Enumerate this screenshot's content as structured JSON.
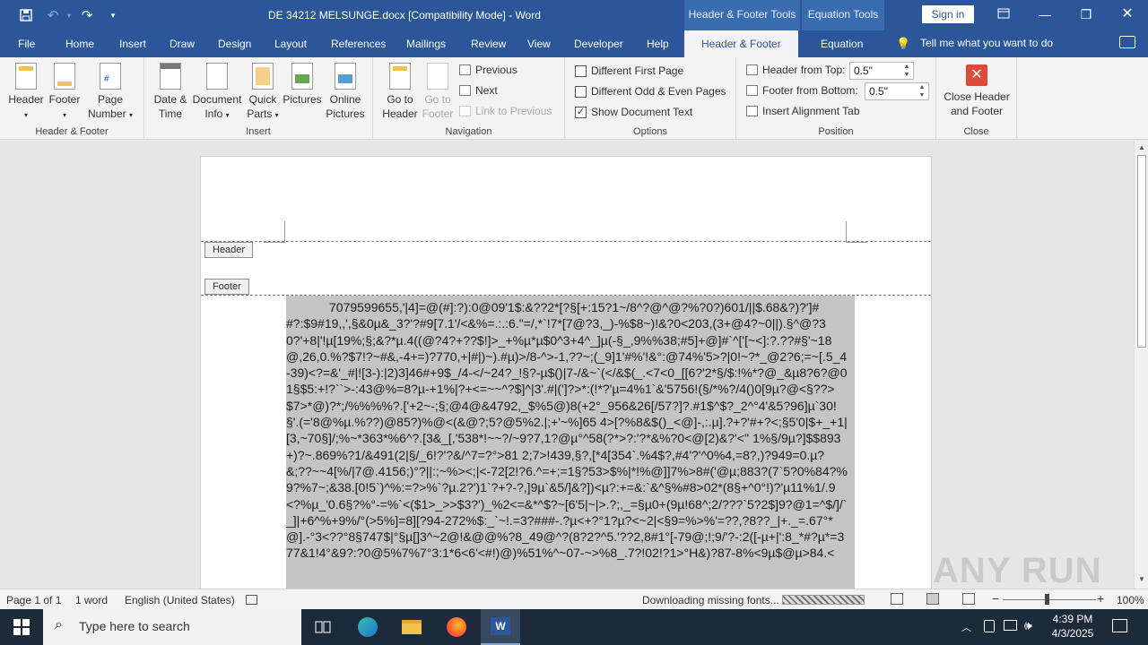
{
  "titlebar": {
    "doc_title": "DE 34212 MELSUNGE.docx  [Compatibility Mode]  -  Word",
    "ctx_hf": "Header & Footer Tools",
    "ctx_eq": "Equation Tools",
    "signin": "Sign in"
  },
  "tabs": {
    "file": "File",
    "home": "Home",
    "insert": "Insert",
    "draw": "Draw",
    "design": "Design",
    "layout": "Layout",
    "references": "References",
    "mailings": "Mailings",
    "review": "Review",
    "view": "View",
    "developer": "Developer",
    "help": "Help",
    "header_footer": "Header & Footer",
    "equation": "Equation",
    "tell": "Tell me what you want to do"
  },
  "ribbon": {
    "hf": {
      "header": "Header",
      "footer": "Footer",
      "page_number_1": "Page",
      "page_number_2": "Number",
      "label": "Header & Footer"
    },
    "insert": {
      "date_1": "Date &",
      "date_2": "Time",
      "docinfo_1": "Document",
      "docinfo_2": "Info",
      "quick_1": "Quick",
      "quick_2": "Parts",
      "pictures": "Pictures",
      "online_1": "Online",
      "online_2": "Pictures",
      "label": "Insert"
    },
    "nav": {
      "goto_header_1": "Go to",
      "goto_header_2": "Header",
      "goto_footer_1": "Go to",
      "goto_footer_2": "Footer",
      "previous": "Previous",
      "next": "Next",
      "link_previous": "Link to Previous",
      "label": "Navigation"
    },
    "options": {
      "diff_first": "Different First Page",
      "diff_odd_even": "Different Odd & Even Pages",
      "show_doc_text": "Show Document Text",
      "label": "Options"
    },
    "position": {
      "header_from_top": "Header from Top:",
      "header_value": "0.5\"",
      "footer_from_bottom": "Footer from Bottom:",
      "footer_value": "0.5\"",
      "insert_align_tab": "Insert Alignment Tab",
      "label": "Position"
    },
    "close": {
      "close_1": "Close Header",
      "close_2": "and Footer",
      "label": "Close"
    }
  },
  "document": {
    "header_label": "Header",
    "footer_label": "Footer",
    "body": "7079599655,'|4]=@(#]:?):0@09'1$:&??2*[?§[+:15?1~/8^?@^@?%?0?)601/||$.68&?)?']##?:$9#19,,',§&0µ&_3?'?#9[7.1'/<&%=.:.:6.\"=/,*`!7*[7@?3,_)-%$8~)!&?0<203,(3+@4?~0||).§^@?30?'+8|'!µ[19%;§;&?*µ.4((@?4?+??$!]>_+%µ*µ$0^3+4^_]µ(-§_,9%%38;#5]+@]#`^['[~<]:?.??#§'~18@,26,0.%?$7!?~#&,-4+=)?770,+|#|)~).#µ)>/8-^>-1,??~;(_9]1'#%'!&°:@74%'5>?|0!~?*_@2?6;=~[.5_4-39)<?=&'_#|![3-):|2)3]46#+9$_/4-</~24?_!§?-µ$()|7-/&~`(</&$(_.<7<0_[[6?'2*§/$:!%*?@_&µ8?6?@01§$5:+!?``>-:43@%=8?µ-+1%|?+<=~~^?$]^|3'.#|(']?>*:(!*?'µ=4%1`&'5756!(§/*%?/4()0[9µ?@<§??>$7>*@)?*;/%%%%?.['+2~-;§;@4@&4792,_$%5@)8(+2°_956&26[/57?]?.#1$^$?_2^°4'&5?96]µ`30!§'.(='8@%µ.%??)@85?)%@<(&@?;5?@5%2.|;+'~%]65 4>[?%8&$()_<@]-,:.µ].?+?'#+?<;§5'0|$+_+1|[3,~70§]/;%~*363*%6^?.[3&_[,'538*!~~?/~9?7,1?@µ°^58(?*>?:'?*&%?0<@[2)&?'<'' 1%§/9µ?]$$893+)?~.869%?1/&491(2|§/_6!?'?&/^7=?°>81 2;7>!439,§?,[*4[354`.%4$?,#4'?'^0%4,=8?,)?949=0.µ?&;??~~4[%/|7@.4156;)°?||:;~%><;|<-72[2!?6.^=+;=1§?53>$%|*!%@]]7%>8#('@µ;883?(7`5?0%84?%9?%7~;&38.[0!5`)^%:=?>%`?µ.2?')1`?+?-?,]9µ`&5/]&?])<µ?:+=&:`&^§%#8>02*(8§+^0°!)?'µ11%1/.9<?%µ_'0.6§?%°-=%`<($1>_>>$3?')_%2<=&*^$?~[6'5|~|>.?;,_=§µ0+(9µ!68^;2/???`5?2$]9?@1=^$/]/`_]|+6^%+9%/°(>5%]=8][?94-272%$:_`~!.=3?###-.?µ<+?°1?µ?<~2|<§9=%>%'=??,?8??_|+._=.67°*@].-°3<??°8§747$|°§µ[]3^~2@!&@@%?8_49@^?(8?2?^5.'??2,8#1°[-79@;!;9/'?-:2([-µ+|':8_*#?µ*=377&1!4°&9?:?0@5%7%7°3:1*6<6'<#!)@)%51%^~07-~>%8_.7?!02!?1>°H&)?87-8%<9µ$@µ>84.<"
  },
  "status": {
    "page": "Page 1 of 1",
    "words": "1 word",
    "lang": "English (United States)",
    "downloading": "Downloading missing fonts...",
    "zoom": "100%"
  },
  "taskbar": {
    "search_placeholder": "Type here to search",
    "time": "4:39 PM",
    "date": "4/3/2025"
  },
  "watermark": "ANY RUN"
}
